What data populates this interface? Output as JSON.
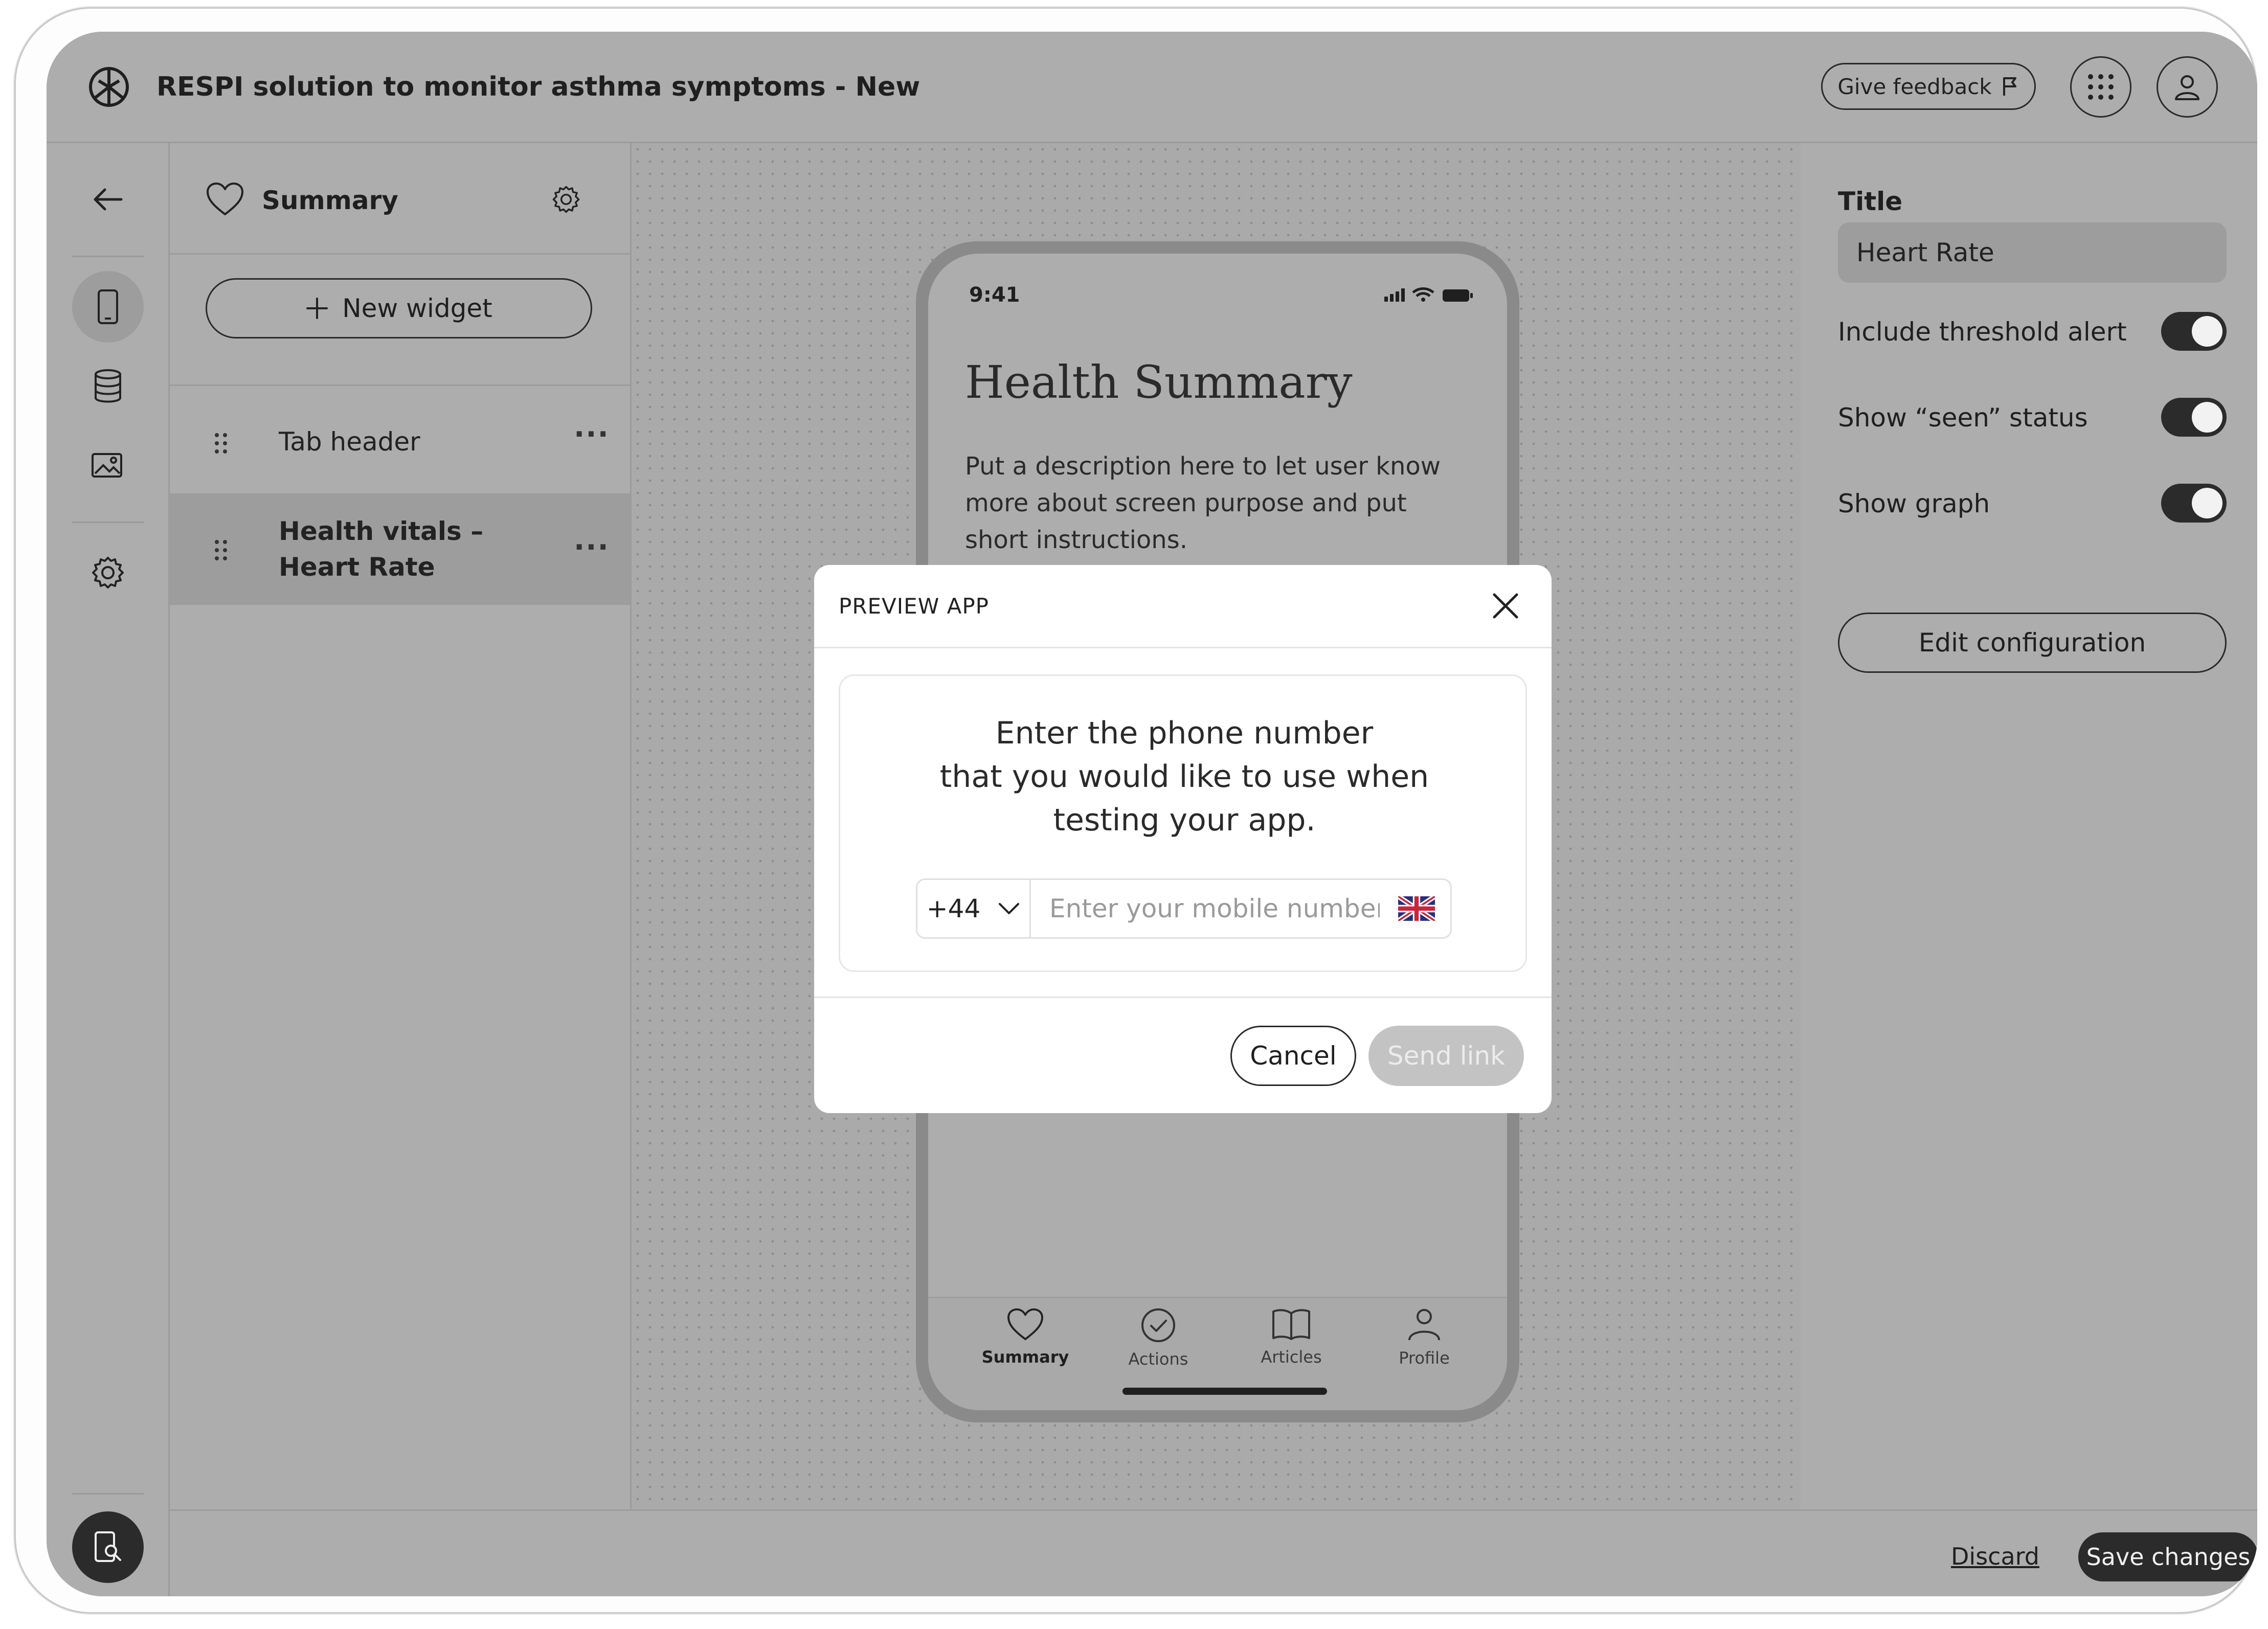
{
  "header": {
    "app_title": "RESPI solution to monitor asthma symptoms - New",
    "feedback_label": "Give feedback"
  },
  "widgets_panel": {
    "title": "Summary",
    "new_widget_label": "New widget",
    "items": [
      {
        "label": "Tab header"
      },
      {
        "label_line1": "Health vitals –",
        "label_line2": "Heart Rate"
      }
    ]
  },
  "phone_preview": {
    "status_time": "9:41",
    "heading": "Health Summary",
    "description": "Put a description here to let user know more about screen purpose and put short instructions.",
    "tabs": [
      {
        "label": "Summary",
        "icon": "heart-icon",
        "active": true
      },
      {
        "label": "Actions",
        "icon": "check-circle-icon",
        "active": false
      },
      {
        "label": "Articles",
        "icon": "book-icon",
        "active": false
      },
      {
        "label": "Profile",
        "icon": "person-icon",
        "active": false
      }
    ]
  },
  "properties": {
    "title_label": "Title",
    "title_value": "Heart Rate",
    "toggles": [
      {
        "label": "Include threshold alert",
        "on": true
      },
      {
        "label": "Show “seen” status",
        "on": true
      },
      {
        "label": "Show graph",
        "on": true
      }
    ],
    "edit_config_label": "Edit configuration"
  },
  "footer": {
    "discard_label": "Discard",
    "save_label": "Save changes"
  },
  "modal": {
    "title": "PREVIEW APP",
    "prompt_line1": "Enter the phone number",
    "prompt_line2": "that you would like to use when",
    "prompt_line3": "testing your app.",
    "country_code": "+44",
    "phone_placeholder": "Enter your mobile number",
    "cancel_label": "Cancel",
    "send_label": "Send link"
  },
  "colors": {
    "overlay": "#adadad",
    "dark": "#2b2b2b",
    "disabled_button": "#c3c3c3"
  }
}
